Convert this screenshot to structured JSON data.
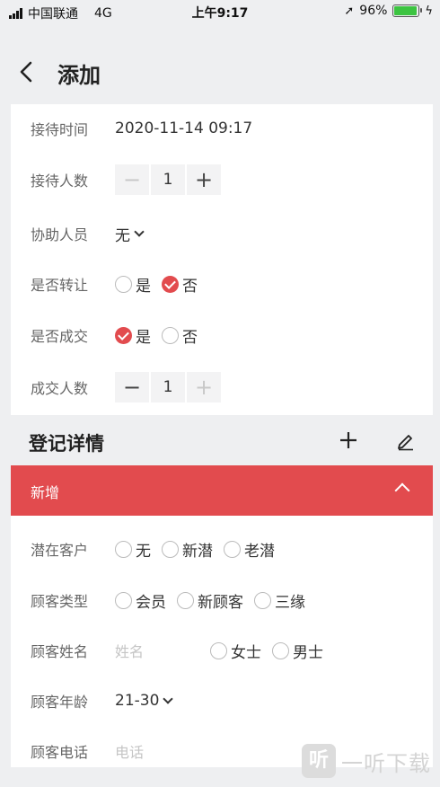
{
  "status_bar": {
    "carrier": "中国联通",
    "network": "4G",
    "time": "上午9:17",
    "battery": "96%",
    "battery_level": 0.96
  },
  "nav": {
    "title": "添加"
  },
  "form": {
    "reception_time": {
      "label": "接待时间",
      "value": "2020-11-14 09:17"
    },
    "reception_count": {
      "label": "接待人数",
      "value": "1"
    },
    "assistant": {
      "label": "协助人员",
      "value": "无"
    },
    "transfer": {
      "label": "是否转让",
      "options": [
        "是",
        "否"
      ],
      "selected": "否"
    },
    "deal": {
      "label": "是否成交",
      "options": [
        "是",
        "否"
      ],
      "selected": "是"
    },
    "deal_count": {
      "label": "成交人数",
      "value": "1"
    }
  },
  "section": {
    "title": "登记详情",
    "panel_label": "新增"
  },
  "detail": {
    "potential": {
      "label": "潜在客户",
      "options": [
        "无",
        "新潜",
        "老潜"
      ]
    },
    "customer_type": {
      "label": "顾客类型",
      "options": [
        "会员",
        "新顾客",
        "三缘"
      ]
    },
    "customer_name": {
      "label": "顾客姓名",
      "placeholder": "姓名",
      "gender_options": [
        "女士",
        "男士"
      ]
    },
    "customer_age": {
      "label": "顾客年龄",
      "value": "21-30"
    },
    "customer_phone": {
      "label": "顾客电话",
      "placeholder": "电话"
    }
  },
  "watermark": {
    "logo": "听",
    "text": "一听下载"
  },
  "colors": {
    "accent": "#e24b4e",
    "battery": "#3cc441"
  }
}
